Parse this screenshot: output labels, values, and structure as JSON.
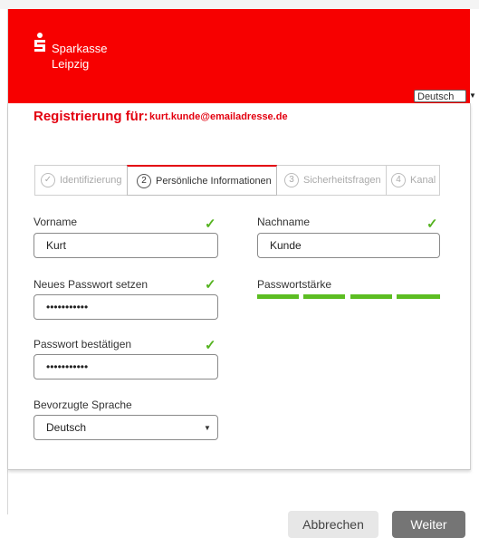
{
  "brand": {
    "line1": "Sparkasse",
    "line2": "Leipzig"
  },
  "language": {
    "selected": "Deutsch"
  },
  "registration": {
    "label": "Registrierung für:",
    "email": "kurt.kunde@emailadresse.de"
  },
  "steps": [
    {
      "num": "✓",
      "label": "Identifizierung"
    },
    {
      "num": "2",
      "label": "Persönliche Informationen"
    },
    {
      "num": "3",
      "label": "Sicherheitsfragen"
    },
    {
      "num": "4",
      "label": "Kanal"
    }
  ],
  "form": {
    "first_name": {
      "label": "Vorname",
      "value": "Kurt"
    },
    "last_name": {
      "label": "Nachname",
      "value": "Kunde"
    },
    "new_password": {
      "label": "Neues Passwort setzen",
      "value": "•••••••••••"
    },
    "password_strength": {
      "label": "Passwortstärke",
      "level": 1.0,
      "color": "#5cbd22"
    },
    "confirm_password": {
      "label": "Passwort bestätigen",
      "value": "•••••••••••"
    },
    "preferred_language": {
      "label": "Bevorzugte Sprache",
      "value": "Deutsch"
    }
  },
  "buttons": {
    "cancel": "Abbrechen",
    "next": "Weiter"
  },
  "icons": {
    "valid": "checkmark-icon",
    "logo": "sparkasse-logo-icon"
  }
}
